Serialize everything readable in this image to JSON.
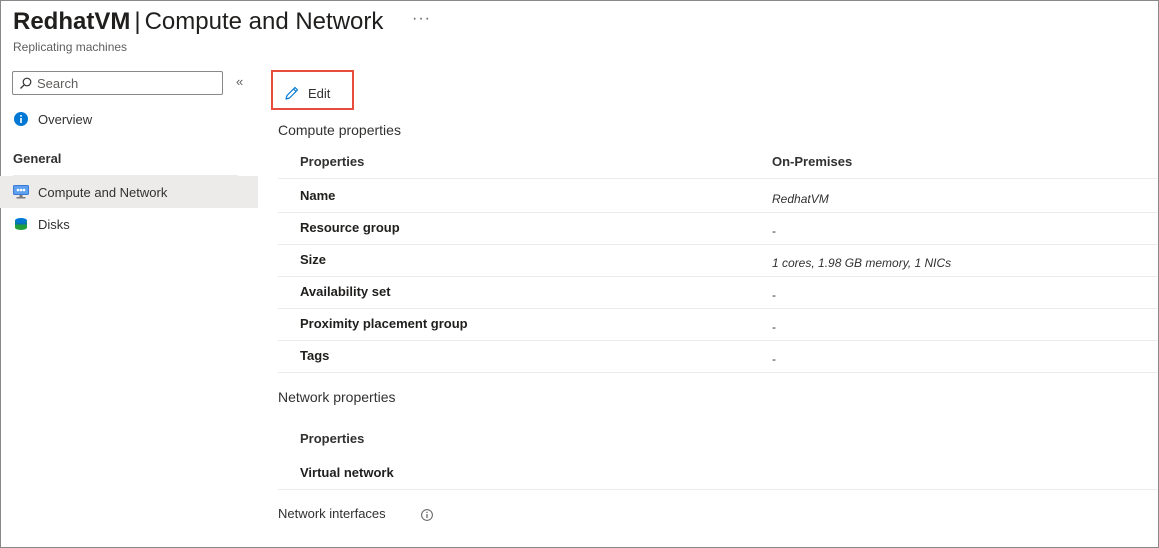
{
  "header": {
    "vm_name": "RedhatVM",
    "separator": "|",
    "page_title": "Compute and Network",
    "more_label": "···",
    "subtitle": "Replicating machines"
  },
  "sidebar": {
    "search_placeholder": "Search",
    "collapse_label": "«",
    "overview_label": "Overview",
    "section_general": "General",
    "items": [
      {
        "label": "Compute and Network",
        "icon": "compute-network-icon",
        "selected": true
      },
      {
        "label": "Disks",
        "icon": "disks-icon",
        "selected": false
      }
    ]
  },
  "toolbar": {
    "edit_label": "Edit"
  },
  "compute": {
    "section_title": "Compute properties",
    "header": {
      "property": "Properties",
      "value": "On-Premises"
    },
    "rows": [
      {
        "property": "Name",
        "value": "RedhatVM"
      },
      {
        "property": "Resource group",
        "value": "-"
      },
      {
        "property": "Size",
        "value": "1 cores, 1.98 GB memory, 1 NICs"
      },
      {
        "property": "Availability set",
        "value": "-"
      },
      {
        "property": "Proximity placement group",
        "value": "-"
      },
      {
        "property": "Tags",
        "value": "-"
      }
    ]
  },
  "network": {
    "section_title": "Network properties",
    "header": {
      "property": "Properties"
    },
    "rows": [
      {
        "property": "Virtual network"
      }
    ],
    "interfaces_title": "Network interfaces"
  },
  "colors": {
    "accent": "#0078d4",
    "highlight_box": "#e74c3c",
    "selected_bg": "#edebe9"
  }
}
